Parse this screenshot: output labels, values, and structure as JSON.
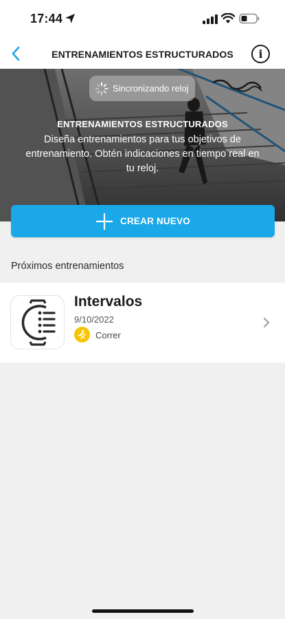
{
  "status_bar": {
    "time": "17:44",
    "icons": [
      "location-arrow-icon",
      "cellular-signal-icon",
      "wifi-icon",
      "battery-icon"
    ]
  },
  "nav": {
    "title": "ENTRENAMIENTOS ESTRUCTURADOS",
    "back_icon": "chevron-left-icon",
    "info_icon": "info-icon",
    "info_glyph": "i"
  },
  "hero": {
    "sync_text": "Sincronizando reloj",
    "title": "ENTRENAMIENTOS ESTRUCTURADOS",
    "description": "Diseña entrenamientos para tus objetivos de entrenamiento. Obtén indicaciones en tiempo real en tu reloj."
  },
  "create_button": {
    "label": "CREAR NUEVO",
    "icon": "plus-icon"
  },
  "upcoming": {
    "section_title": "Próximos entrenamientos",
    "items": [
      {
        "name": "Intervalos",
        "date": "9/10/2022",
        "sport": "Correr",
        "sport_icon": "running-icon",
        "thumb_icon": "watch-workout-icon"
      }
    ]
  },
  "colors": {
    "accent": "#1aa8e8",
    "sport_badge": "#f6c400",
    "background": "#f0f0f0"
  }
}
